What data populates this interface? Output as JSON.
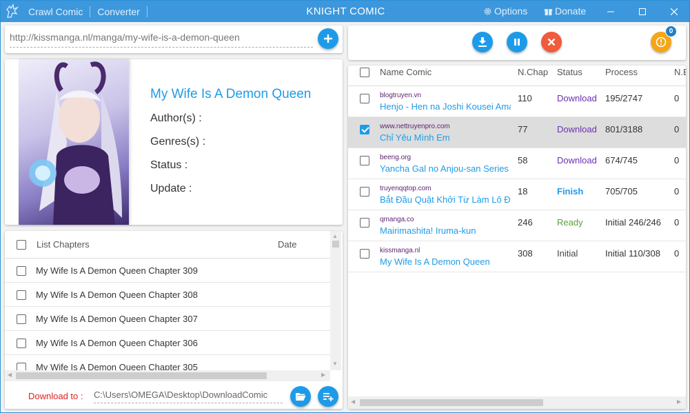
{
  "titlebar": {
    "nav_crawl": "Crawl Comic",
    "nav_converter": "Converter",
    "title": "KNIGHT COMIC",
    "options": "Options",
    "donate": "Donate"
  },
  "url_input": {
    "value": "http://kissmanga.nl/manga/my-wife-is-a-demon-queen"
  },
  "manga_info": {
    "title": "My Wife Is A Demon Queen",
    "author_label": "Author(s) :",
    "genres_label": "Genres(s)  :",
    "status_label": "Status    :",
    "update_label": "Update :"
  },
  "chapters": {
    "col_list": "List Chapters",
    "col_date": "Date",
    "items": [
      "My Wife Is A Demon Queen Chapter 309",
      "My Wife Is A Demon Queen Chapter 308",
      "My Wife Is A Demon Queen Chapter 307",
      "My Wife Is A Demon Queen Chapter 306",
      "My Wife Is A Demon Queen Chapter 305"
    ]
  },
  "download": {
    "label": "Download to :",
    "path": "C:\\Users\\OMEGA\\Desktop\\DownloadComic"
  },
  "queue": {
    "badge": "0"
  },
  "table": {
    "headers": {
      "name": "Name Comic",
      "nchap": "N.Chap",
      "status": "Status",
      "process": "Process",
      "ne": "N.E"
    },
    "rows": [
      {
        "site": "blogtruyen.vn",
        "name": "Henjo - Hen na Joshi Kousei Amano Jaku",
        "nchap": "110",
        "status": "Download",
        "process": "195/2747",
        "ne": "0"
      },
      {
        "site": "www.nettruyenpro.com",
        "name": "Chỉ Yêu Mình Em",
        "nchap": "77",
        "status": "Download",
        "process": "801/3188",
        "ne": "0"
      },
      {
        "site": "beeng.org",
        "name": "Yancha Gal no Anjou-san Series",
        "nchap": "58",
        "status": "Download",
        "process": "674/745",
        "ne": "0"
      },
      {
        "site": "truyenqqtop.com",
        "name": "Bắt Đầu Quật Khởi Từ Làm Lô Đỉnh",
        "nchap": "18",
        "status": "Finish",
        "process": "705/705",
        "ne": "0"
      },
      {
        "site": "qmanga.co",
        "name": "Mairimashita! Iruma-kun",
        "nchap": "246",
        "status": "Ready",
        "process": "Initial 246/246",
        "ne": "0"
      },
      {
        "site": "kissmanga.nl",
        "name": "My Wife Is A Demon Queen",
        "nchap": "308",
        "status": "Initial",
        "process": "Initial 110/308",
        "ne": "0"
      }
    ]
  },
  "colors": {
    "accent": "#1e9be8",
    "titlebar": "#3d97dc",
    "status_download": "#6a2fb0",
    "status_finish": "#1e9be8",
    "status_ready": "#5c9e3a",
    "download_label": "#e02020"
  }
}
